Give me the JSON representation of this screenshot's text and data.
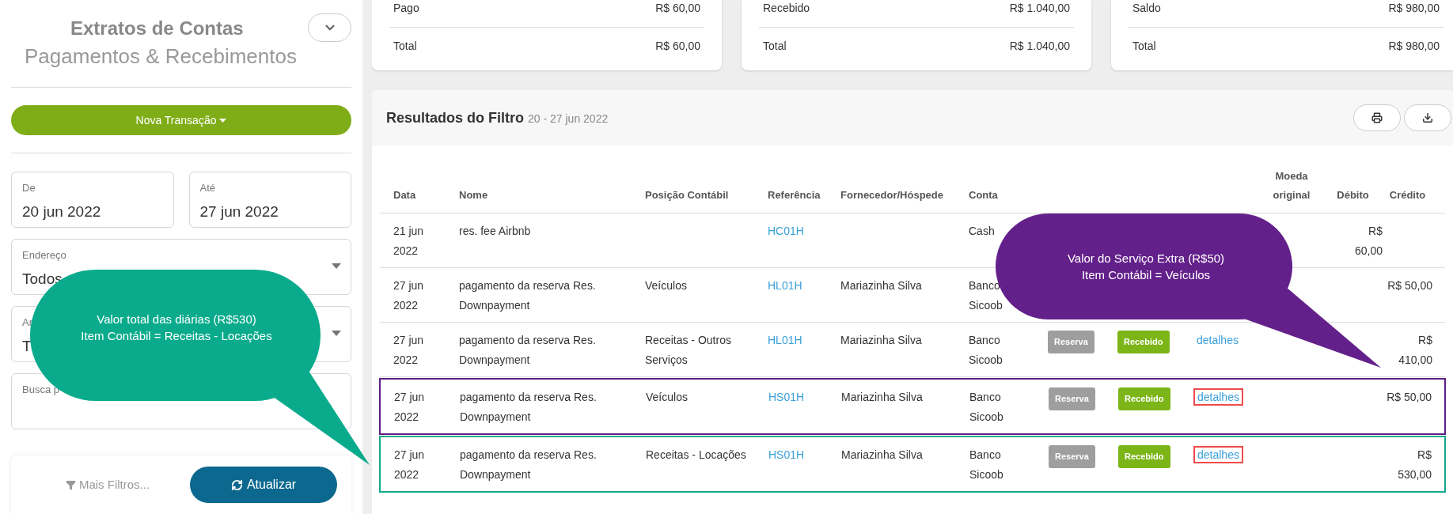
{
  "sidebar": {
    "title": "Extratos de Contas",
    "subtitle": "Pagamentos & Recebimentos",
    "new_button": "Nova Transação",
    "fields": [
      {
        "kind": "date",
        "label": "De",
        "value": "20 jun 2022"
      },
      {
        "kind": "date",
        "label": "Até",
        "value": "27 jun 2022"
      },
      {
        "kind": "select",
        "label": "Endereço",
        "value": "Todos"
      },
      {
        "kind": "select",
        "label": "Ar",
        "value": "T"
      },
      {
        "kind": "search",
        "label": "Busca p"
      }
    ],
    "more_filters": "Mais Filtros...",
    "refresh_button": "Atualizar"
  },
  "summary_cards": [
    {
      "rows": [
        {
          "label": "Pago",
          "value": "R$ 60,00"
        },
        {
          "label": "Total",
          "value": "R$ 60,00"
        }
      ]
    },
    {
      "rows": [
        {
          "label": "Recebido",
          "value": "R$ 1.040,00"
        },
        {
          "label": "Total",
          "value": "R$ 1.040,00"
        }
      ]
    },
    {
      "rows": [
        {
          "label": "Saldo",
          "value": "R$ 980,00"
        },
        {
          "label": "Total",
          "value": "R$ 980,00"
        }
      ]
    }
  ],
  "results": {
    "title": "Resultados do Filtro",
    "date_range": "20 - 27 jun 2022",
    "table": {
      "columns": [
        "Data",
        "Nome",
        "Posição Contábil",
        "Referência",
        "Fornecedor/Hóspede",
        "Conta",
        "Moeda original",
        "Débito",
        "Crédito"
      ],
      "rows": [
        {
          "date": "21 jun 2022",
          "name": "res. fee Airbnb",
          "reference": "HC01H",
          "account": "Cash",
          "debit": "R$ 60,00"
        },
        {
          "date": "27 jun 2022",
          "name": "pagamento da reserva Res. Downpayment",
          "position": "Veículos",
          "reference": "HL01H",
          "party": "Mariazinha Silva",
          "account": "Banco Sicoob",
          "credit": "R$ 50,00"
        },
        {
          "date": "27 jun 2022",
          "name": "pagamento da reserva Res. Downpayment",
          "position": "Receitas - Outros Serviços",
          "reference": "HL01H",
          "party": "Mariazinha Silva",
          "account": "Banco Sicoob",
          "tag": {
            "label": "Reserva",
            "color": "#9e9e9e"
          },
          "status": {
            "label": "Recebido",
            "color": "#7cb518"
          },
          "link": {
            "label": "detalhes",
            "highlighted": false
          },
          "credit": "R$ 410,00"
        },
        {
          "date": "27 jun 2022",
          "name": "pagamento da reserva Res. Downpayment",
          "position": "Veículos",
          "reference": "HS01H",
          "party": "Mariazinha Silva",
          "account": "Banco Sicoob",
          "tag": {
            "label": "Reserva",
            "color": "#9e9e9e"
          },
          "status": {
            "label": "Recebido",
            "color": "#7cb518"
          },
          "link": {
            "label": "detalhes",
            "highlighted": true
          },
          "credit": "R$ 50,00",
          "color": "#5c1f87"
        },
        {
          "date": "27 jun 2022",
          "name": "pagamento da reserva Res. Downpayment",
          "position": "Receitas - Locações",
          "reference": "HS01H",
          "party": "Mariazinha Silva",
          "account": "Banco Sicoob",
          "tag": {
            "label": "Reserva",
            "color": "#9e9e9e"
          },
          "status": {
            "label": "Recebido",
            "color": "#7cb518"
          },
          "link": {
            "label": "detalhes",
            "highlighted": true
          },
          "credit": "R$ 530,00",
          "color": "#13a88a"
        }
      ]
    }
  },
  "callouts": [
    {
      "kind": "left",
      "lines": [
        "Valor total das diárias (R$530)",
        "Item Contábil = Receitas - Locações"
      ],
      "color": "#09ab8c"
    },
    {
      "kind": "right",
      "lines": [
        "Valor do Serviço Extra (R$50)",
        "Item Contábil = Veículos"
      ],
      "color": "#63208a"
    }
  ]
}
